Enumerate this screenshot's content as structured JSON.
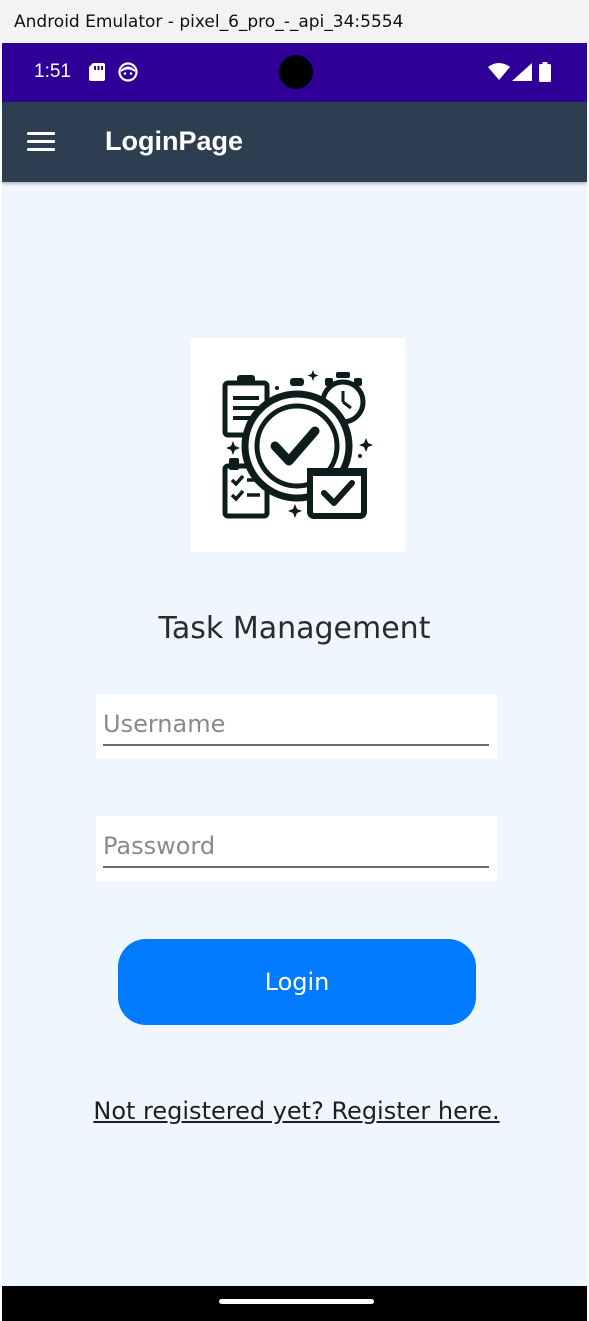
{
  "window": {
    "title": "Android Emulator - pixel_6_pro_-_api_34:5554"
  },
  "statusbar": {
    "time": "1:51",
    "icons": [
      "sd-card-icon",
      "notification-face-icon",
      "wifi-icon",
      "cell-signal-icon",
      "battery-icon"
    ],
    "color": "#2f0097"
  },
  "appbar": {
    "title": "LoginPage",
    "menu_icon": "hamburger-menu-icon",
    "color": "#2c3e50"
  },
  "main": {
    "logo_icon": "task-management-logo",
    "title": "Task Management",
    "username": {
      "placeholder": "Username",
      "value": ""
    },
    "password": {
      "placeholder": "Password",
      "value": ""
    },
    "login_label": "Login",
    "register_link": "Not registered yet? Register here.",
    "accent": "#007bff",
    "background": "#eff6fd"
  }
}
